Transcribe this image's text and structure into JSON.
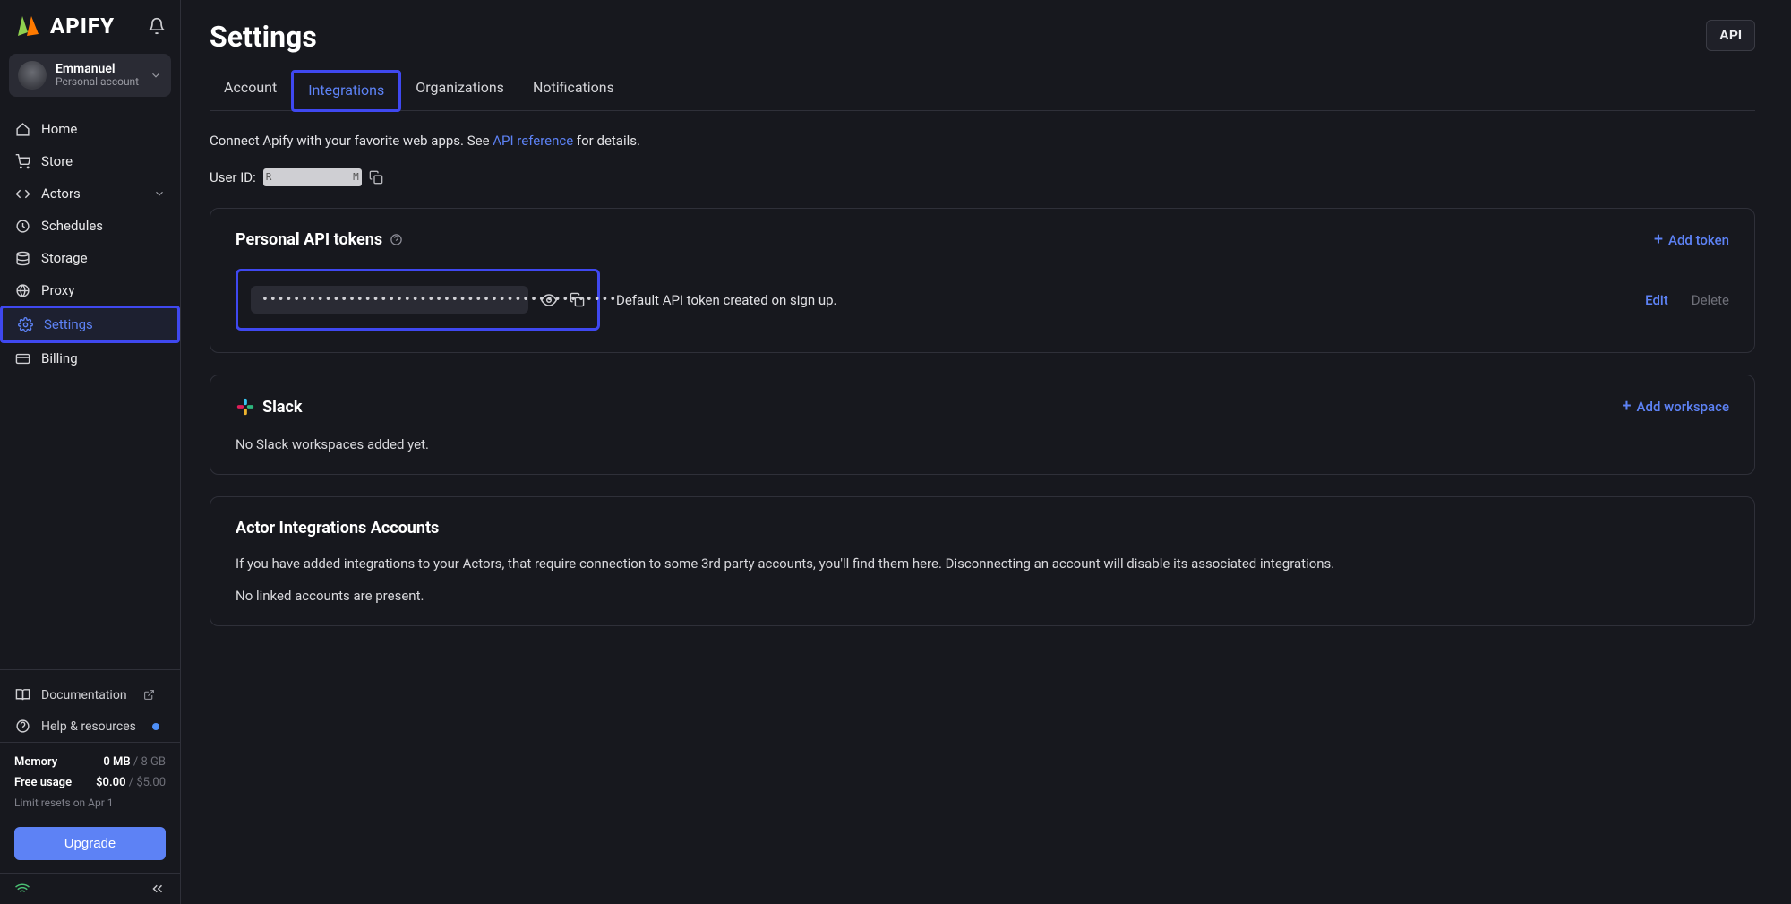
{
  "brand": {
    "name": "APIFY"
  },
  "account": {
    "name": "Emmanuel",
    "subtitle": "Personal account"
  },
  "sidebar": {
    "items": [
      {
        "label": "Home"
      },
      {
        "label": "Store"
      },
      {
        "label": "Actors"
      },
      {
        "label": "Schedules"
      },
      {
        "label": "Storage"
      },
      {
        "label": "Proxy"
      },
      {
        "label": "Settings"
      },
      {
        "label": "Billing"
      }
    ],
    "secondary": [
      {
        "label": "Documentation"
      },
      {
        "label": "Help & resources"
      }
    ]
  },
  "usage": {
    "memory": {
      "label": "Memory",
      "current": "0 MB",
      "max": "8 GB"
    },
    "free": {
      "label": "Free usage",
      "current": "$0.00",
      "max": "$5.00"
    },
    "note": "Limit resets on Apr 1",
    "upgrade_label": "Upgrade"
  },
  "page": {
    "title": "Settings",
    "api_button": "API",
    "tabs": [
      "Account",
      "Integrations",
      "Organizations",
      "Notifications"
    ],
    "active_tab": 1,
    "intro_prefix": "Connect Apify with your favorite web apps. See ",
    "intro_link": "API reference",
    "intro_suffix": " for details.",
    "userid_label": "User ID:"
  },
  "tokens": {
    "title": "Personal API tokens",
    "add_label": "Add token",
    "masked_value": "•••••••••••••••••••••••••••••••••••••••••••••",
    "description": "Default API token created on sign up.",
    "edit_label": "Edit",
    "delete_label": "Delete"
  },
  "slack": {
    "title": "Slack",
    "add_label": "Add workspace",
    "empty": "No Slack workspaces added yet."
  },
  "actor_accounts": {
    "title": "Actor Integrations Accounts",
    "description": "If you have added integrations to your Actors, that require connection to some 3rd party accounts, you'll find them here. Disconnecting an account will disable its associated integrations.",
    "empty": "No linked accounts are present."
  }
}
